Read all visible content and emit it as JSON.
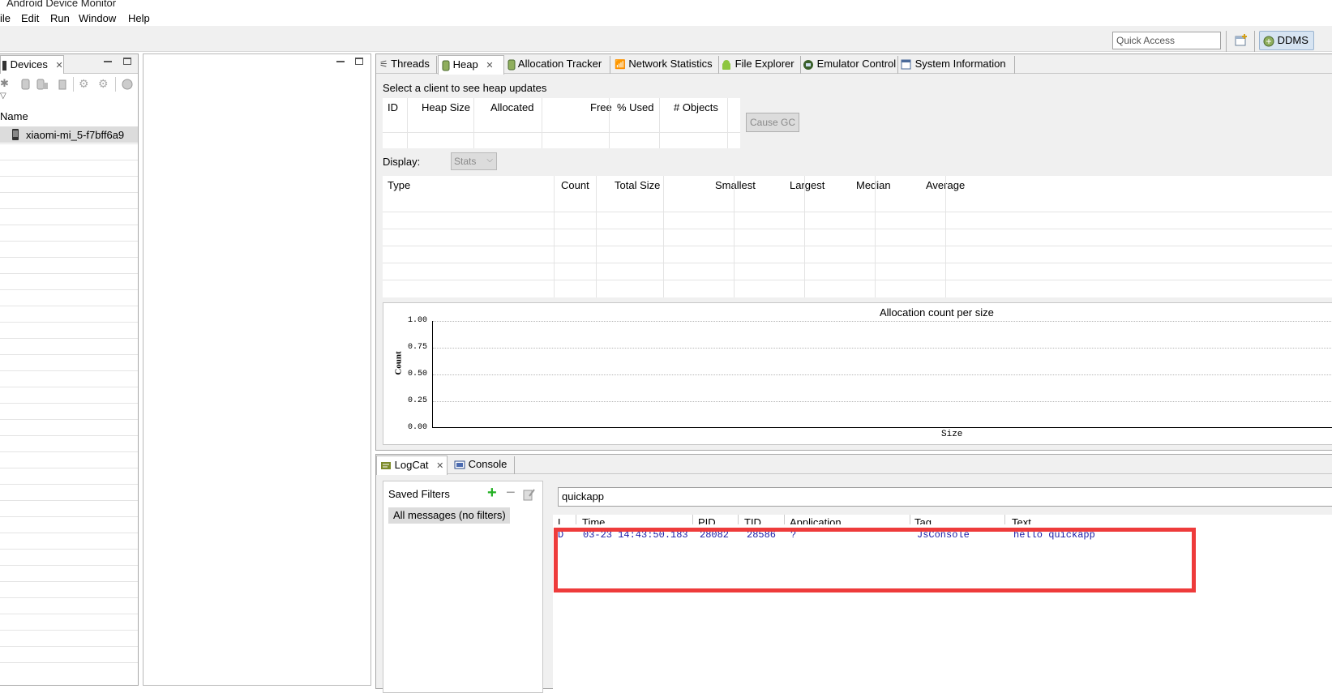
{
  "window": {
    "title": "Android Device Monitor"
  },
  "menu": [
    "ile",
    "Edit",
    "Run",
    "Window",
    "Help"
  ],
  "toolbar": {
    "quick_access_placeholder": "Quick Access",
    "perspective": "DDMS"
  },
  "devices": {
    "tab_label": "Devices",
    "column_name": "Name",
    "items": [
      {
        "label": "xiaomi-mi_5-f7bff6a9"
      }
    ]
  },
  "top_tabs": [
    {
      "label": "Threads",
      "icon": "threads-icon"
    },
    {
      "label": "Heap",
      "icon": "heap-icon",
      "active": true
    },
    {
      "label": "Allocation Tracker",
      "icon": "allocation-icon"
    },
    {
      "label": "Network Statistics",
      "icon": "wifi-icon"
    },
    {
      "label": "File Explorer",
      "icon": "android-icon"
    },
    {
      "label": "Emulator Control",
      "icon": "emulator-icon"
    },
    {
      "label": "System Information",
      "icon": "window-icon"
    }
  ],
  "heap": {
    "status": "Select a client to see heap updates",
    "columns": [
      "ID",
      "Heap Size",
      "Allocated",
      "Free",
      "% Used",
      "# Objects"
    ],
    "cause_gc": "Cause GC",
    "display_label": "Display:",
    "display_value": "Stats",
    "type_columns": [
      "Type",
      "Count",
      "Total Size",
      "Smallest",
      "Largest",
      "Median",
      "Average"
    ]
  },
  "chart_data": {
    "type": "bar",
    "title": "Allocation count per size",
    "xlabel": "Size",
    "ylabel": "Count",
    "ylim": [
      0,
      1
    ],
    "yticks": [
      "1.00",
      "0.75",
      "0.50",
      "0.25",
      "0.00"
    ],
    "categories": [],
    "values": [],
    "grid": true
  },
  "bottom_tabs": [
    {
      "label": "LogCat",
      "icon": "logcat-icon",
      "active": true
    },
    {
      "label": "Console",
      "icon": "console-icon"
    }
  ],
  "logcat": {
    "saved_filters_label": "Saved Filters",
    "filter_item": "All messages (no filters)",
    "search_value": "quickapp",
    "columns": [
      "L",
      "Time",
      "PID",
      "TID",
      "Application",
      "Tag",
      "Text"
    ],
    "rows": [
      {
        "level": "D",
        "time": "03-23 14:43:50.183",
        "pid": "28082",
        "tid": "28586",
        "app": "?",
        "tag": "JsConsole",
        "text": "hello quickapp"
      }
    ]
  },
  "colors": {
    "highlight": "#ee3b3b",
    "log_text": "#1a1aa6"
  }
}
